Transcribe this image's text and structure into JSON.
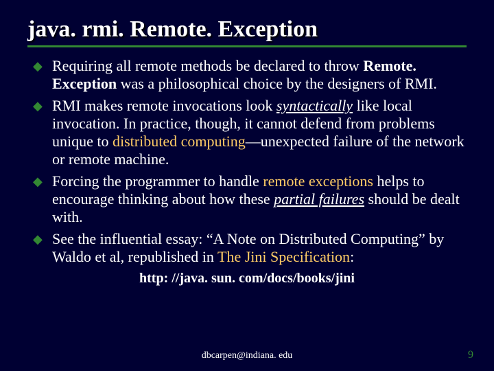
{
  "title": "java. rmi. Remote. Exception",
  "bullets": [
    {
      "pre": "Requiring all remote methods be declared to throw ",
      "em1": "Remote. Exception",
      "post": " was a philosophical choice by the designers of RMI."
    },
    {
      "pre": "RMI makes remote invocations look ",
      "em1": "syntactically",
      "mid": " like local invocation.  In practice, though, it cannot defend from problems unique to ",
      "em2": "distributed computing",
      "post": "—unexpected failure of the network or remote machine."
    },
    {
      "pre": "Forcing the programmer to handle ",
      "em1": "remote exceptions",
      "mid": " helps to encourage thinking about how these ",
      "em2": "partial failures",
      "post": " should be dealt with."
    },
    {
      "pre": "See the influential essay: “A Note on Distributed Computing” by Waldo et al, republished in ",
      "em1": "The Jini Specification",
      "post": ":"
    }
  ],
  "link": "http: //java. sun. com/docs/books/jini",
  "footer": "dbcarpen@indiana. edu",
  "page": "9"
}
